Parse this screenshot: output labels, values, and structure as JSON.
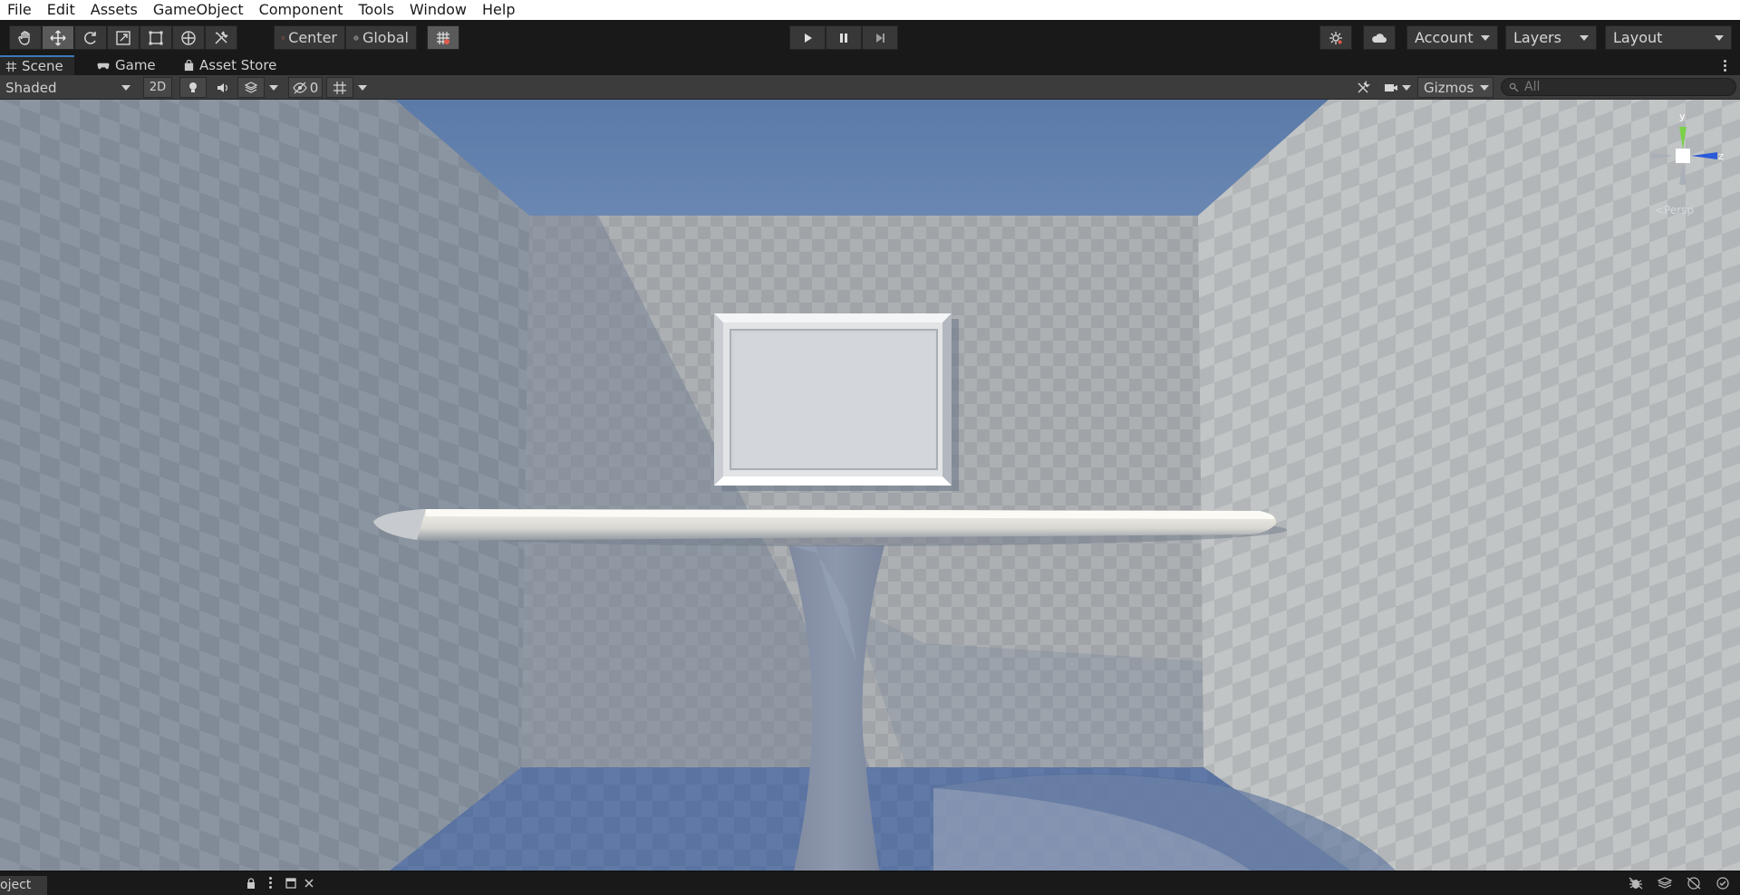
{
  "menu": [
    "File",
    "Edit",
    "Assets",
    "GameObject",
    "Component",
    "Tools",
    "Window",
    "Help"
  ],
  "toolbar": {
    "pivot_label": "Center",
    "space_label": "Global",
    "account_label": "Account",
    "layers_label": "Layers",
    "layout_label": "Layout"
  },
  "tabs": {
    "scene": "Scene",
    "game": "Game",
    "asset_store": "Asset Store"
  },
  "scene_toolbar": {
    "draw_mode": "Shaded",
    "mode_2d": "2D",
    "hidden_count": "0",
    "gizmos_label": "Gizmos",
    "search_placeholder": "All"
  },
  "gizmo": {
    "y_label": "y",
    "z_label": "z",
    "projection_label": "<Persp"
  },
  "bottom": {
    "tab_label": "oject"
  },
  "colors": {
    "accent": "#3a79bb",
    "sky": "#5f7faa",
    "floor": "#5a74a0",
    "wall": "#a3a7ab"
  }
}
